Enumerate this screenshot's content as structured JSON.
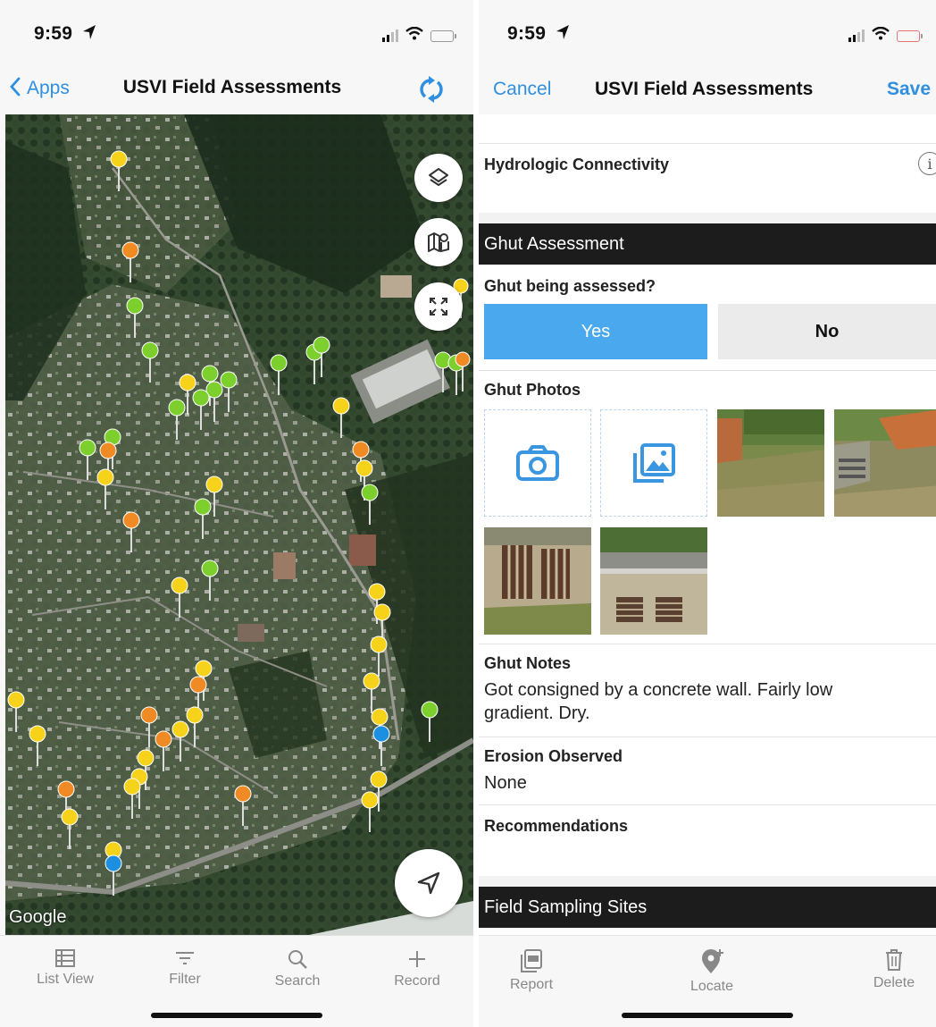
{
  "left": {
    "status": {
      "time": "9:59"
    },
    "navbar": {
      "back_label": "Apps",
      "title": "USVI Field Assessments"
    },
    "map": {
      "attribution": "Google",
      "colors": {
        "yellow": "#f6d21a",
        "orange": "#f08a24",
        "green": "#7ccf2d",
        "blue": "#1c8fe0"
      },
      "icons": [
        "layers-icon",
        "basemap-icon",
        "expand-icon",
        "locate-arrow-icon"
      ]
    },
    "tabs": [
      {
        "label": "List View",
        "icon": "list-icon"
      },
      {
        "label": "Filter",
        "icon": "filter-icon"
      },
      {
        "label": "Search",
        "icon": "search-icon"
      },
      {
        "label": "Record",
        "icon": "plus-icon"
      }
    ]
  },
  "right": {
    "status": {
      "time": "9:59"
    },
    "navbar": {
      "cancel_label": "Cancel",
      "title": "USVI Field Assessments",
      "save_label": "Save"
    },
    "form": {
      "hydro_label": "Hydrologic Connectivity",
      "ghut_section": "Ghut Assessment",
      "assessed_label": "Ghut being assessed?",
      "yes_label": "Yes",
      "no_label": "No",
      "photos_label": "Ghut Photos",
      "notes_label": "Ghut Notes",
      "notes_value": "Got consigned by a concrete wall. Fairly low gradient. Dry.",
      "erosion_label": "Erosion Observed",
      "erosion_value": "None",
      "recommendations_label": "Recommendations",
      "sampling_section": "Field Sampling Sites"
    },
    "colors": {
      "accent": "#2f8fe0",
      "selected": "#4aa8ee",
      "section_bar": "#1c1c1c"
    },
    "tabs": [
      {
        "label": "Report",
        "icon": "pdf-icon"
      },
      {
        "label": "Locate",
        "icon": "locate-pin-icon"
      },
      {
        "label": "Delete",
        "icon": "trash-icon"
      }
    ]
  }
}
